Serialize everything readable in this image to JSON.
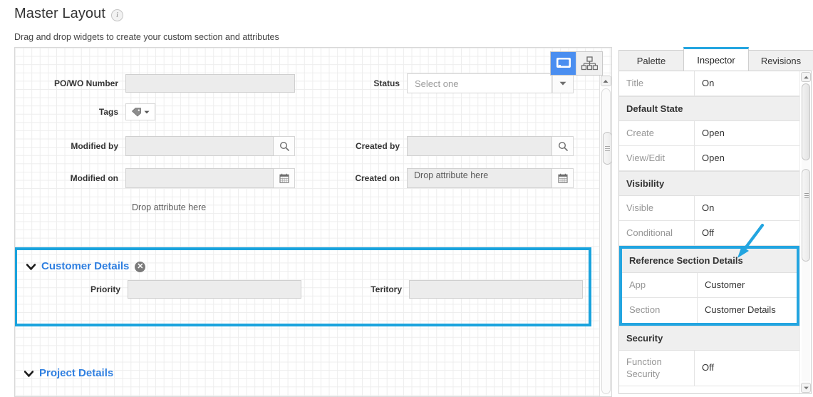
{
  "header": {
    "title": "Master Layout",
    "info_icon": "info-icon",
    "subtitle": "Drag and drop widgets to create your custom section and attributes"
  },
  "canvas": {
    "view_toggle": [
      {
        "name": "desktop-view",
        "icon": "monitor-icon",
        "active": true
      },
      {
        "name": "hierarchy-view",
        "icon": "sitemap-icon",
        "active": false
      }
    ],
    "fields_left": [
      {
        "label": "PO/WO Number",
        "type": "text",
        "value": ""
      },
      {
        "label": "Tags",
        "type": "tag-picker",
        "value": ""
      },
      {
        "label": "Modified by",
        "type": "lookup",
        "value": "",
        "addon": "search-icon"
      },
      {
        "label": "Modified on",
        "type": "date",
        "value": "",
        "addon": "calendar-icon"
      }
    ],
    "fields_right": [
      {
        "label": "Status",
        "type": "select",
        "value": "",
        "placeholder": "Select one"
      },
      {
        "label": "Created by",
        "type": "lookup",
        "value": "",
        "addon": "search-icon"
      },
      {
        "label": "Created on",
        "type": "date",
        "value": "",
        "addon": "calendar-icon"
      }
    ],
    "drop_hint_left": "Drop attribute here",
    "drop_hint_right": "Drop attribute here",
    "sections": [
      {
        "title": "Customer Details",
        "selected": true,
        "collapse_icon": "chevron-down-icon",
        "delete_icon": "close-circle-icon",
        "fields": [
          {
            "label": "Priority",
            "value": ""
          },
          {
            "label": "Teritory",
            "value": ""
          }
        ]
      },
      {
        "title": "Project Details",
        "selected": false,
        "collapse_icon": "chevron-down-icon",
        "fields": []
      }
    ]
  },
  "panel": {
    "tabs": [
      {
        "label": "Palette",
        "active": false
      },
      {
        "label": "Inspector",
        "active": true
      },
      {
        "label": "Revisions",
        "active": false
      }
    ],
    "properties": [
      {
        "kind": "row",
        "key": "Title",
        "value": "On"
      },
      {
        "kind": "group",
        "key": "Default State"
      },
      {
        "kind": "row",
        "key": "Create",
        "value": "Open"
      },
      {
        "kind": "row",
        "key": "View/Edit",
        "value": "Open"
      },
      {
        "kind": "group",
        "key": "Visibility"
      },
      {
        "kind": "row",
        "key": "Visible",
        "value": "On"
      },
      {
        "kind": "row",
        "key": "Conditional",
        "value": "Off"
      }
    ],
    "reference_block": {
      "group": "Reference Section Details",
      "rows": [
        {
          "key": "App",
          "value": "Customer"
        },
        {
          "key": "Section",
          "value": "Customer Details"
        }
      ]
    },
    "properties_after": [
      {
        "kind": "group",
        "key": "Security"
      },
      {
        "kind": "row",
        "key": "Function Security",
        "value": "Off"
      }
    ]
  },
  "annotation": {
    "arrow": "arrow-down-left",
    "color": "#23a5e0"
  },
  "colors": {
    "highlight": "#23a5e0",
    "section_title": "#2f7fe0",
    "toggle_active": "#4a8ef0"
  }
}
